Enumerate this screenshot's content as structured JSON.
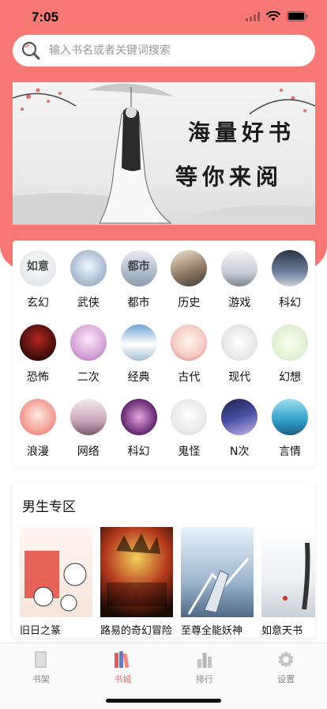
{
  "status": {
    "time": "7:05"
  },
  "search": {
    "placeholder": "输入书名或者关键词搜索"
  },
  "banner": {
    "line1": "海量好书",
    "line2": "等你来阅"
  },
  "categories": [
    {
      "label": "玄幻",
      "glyph": "如意"
    },
    {
      "label": "武侠",
      "glyph": ""
    },
    {
      "label": "都市",
      "glyph": "都市"
    },
    {
      "label": "历史",
      "glyph": ""
    },
    {
      "label": "游戏",
      "glyph": ""
    },
    {
      "label": "科幻",
      "glyph": ""
    },
    {
      "label": "恐怖",
      "glyph": ""
    },
    {
      "label": "二次",
      "glyph": ""
    },
    {
      "label": "经典",
      "glyph": ""
    },
    {
      "label": "古代",
      "glyph": ""
    },
    {
      "label": "现代",
      "glyph": ""
    },
    {
      "label": "幻想",
      "glyph": ""
    },
    {
      "label": "浪漫",
      "glyph": ""
    },
    {
      "label": "网络",
      "glyph": ""
    },
    {
      "label": "科幻",
      "glyph": ""
    },
    {
      "label": "鬼怪",
      "glyph": ""
    },
    {
      "label": "N次",
      "glyph": ""
    },
    {
      "label": "言情",
      "glyph": ""
    }
  ],
  "male_section": {
    "title": "男生专区",
    "books": [
      {
        "title": "旧日之篆"
      },
      {
        "title": "路易的奇幻冒险"
      },
      {
        "title": "至尊全能妖神"
      },
      {
        "title": "如意天书"
      }
    ]
  },
  "tabs": [
    {
      "label": "书架",
      "icon": "book-shelf-icon",
      "active": false
    },
    {
      "label": "书城",
      "icon": "books-icon",
      "active": true
    },
    {
      "label": "排行",
      "icon": "bar-chart-icon",
      "active": false
    },
    {
      "label": "设置",
      "icon": "gear-icon",
      "active": false
    }
  ],
  "colors": {
    "accent": "#f87876",
    "tab_active": "#f26a6a",
    "tab_inactive": "#8a8a8a"
  }
}
